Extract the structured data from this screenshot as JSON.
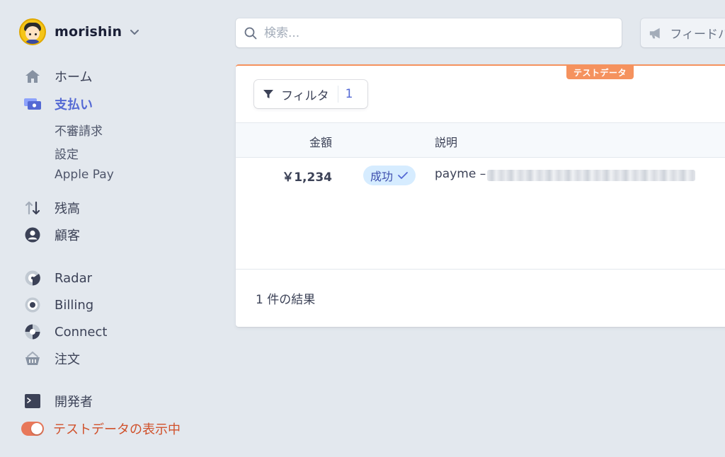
{
  "account": {
    "name": "morishin"
  },
  "nav": {
    "home": "ホーム",
    "payments": "支払い",
    "payments_sub": [
      "不審請求",
      "設定",
      "Apple Pay"
    ],
    "balances": "残高",
    "customers": "顧客",
    "radar": "Radar",
    "billing": "Billing",
    "connect": "Connect",
    "orders": "注文",
    "developers": "開発者",
    "test_data_toggle": "テストデータの表示中"
  },
  "search": {
    "placeholder": "検索..."
  },
  "feedback": {
    "label": "フィードバック"
  },
  "card": {
    "test_badge": "テストデータ",
    "filter": {
      "label": "フィルタ",
      "count": "1"
    },
    "columns": {
      "amount": "金額",
      "description": "説明"
    },
    "rows": [
      {
        "amount": "￥1,234",
        "status": "成功",
        "description": "payme –"
      }
    ],
    "result_count": "1 件の結果"
  },
  "colors": {
    "accent": "#5469d4",
    "test_orange": "#f5925e",
    "toggle_text": "#d0512b",
    "status_bg": "#d6ecff",
    "background": "#e3e8ee"
  },
  "icons": [
    "home-icon",
    "payments-icon",
    "balances-icon",
    "customers-icon",
    "radar-icon",
    "billing-icon",
    "connect-icon",
    "orders-icon",
    "developers-icon",
    "search-icon",
    "megaphone-icon",
    "filter-icon",
    "checkmark-icon",
    "chevron-down-icon"
  ]
}
